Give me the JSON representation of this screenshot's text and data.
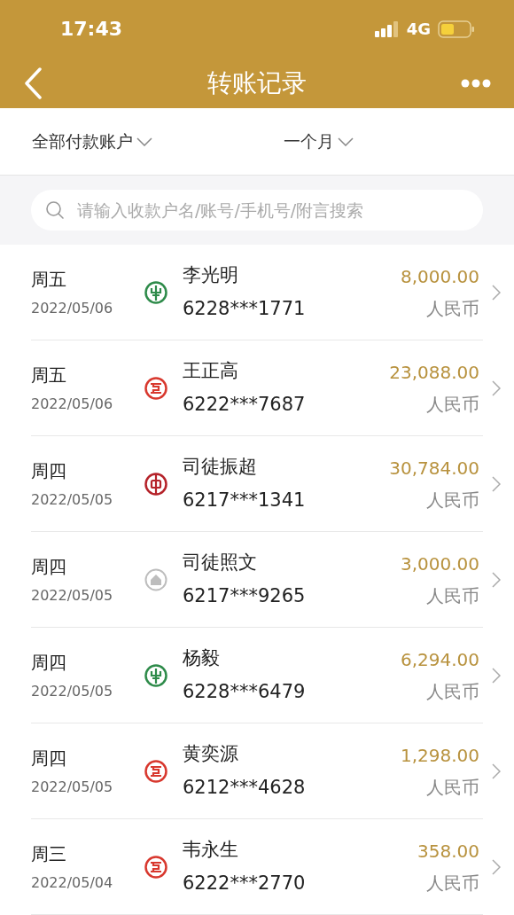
{
  "status_bar": {
    "time": "17:43",
    "network": "4G"
  },
  "nav": {
    "title": "转账记录"
  },
  "filters": [
    {
      "label": "全部付款账户"
    },
    {
      "label": "一个月"
    }
  ],
  "search": {
    "placeholder": "请输入收款户名/账号/手机号/附言搜索"
  },
  "records": [
    {
      "weekday": "周五",
      "date": "2022/05/06",
      "kind": "abc",
      "color": "#2e8b4a",
      "name": "李光明",
      "account": "6228***1771",
      "amount": "8,000.00",
      "currency": "人民币"
    },
    {
      "weekday": "周五",
      "date": "2022/05/06",
      "kind": "icbc",
      "color": "#d8382e",
      "name": "王正高",
      "account": "6222***7687",
      "amount": "23,088.00",
      "currency": "人民币"
    },
    {
      "weekday": "周四",
      "date": "2022/05/05",
      "kind": "boc",
      "color": "#b5232a",
      "name": "司徒振超",
      "account": "6217***1341",
      "amount": "30,784.00",
      "currency": "人民币"
    },
    {
      "weekday": "周四",
      "date": "2022/05/05",
      "kind": "generic",
      "color": "#bdbdbd",
      "name": "司徒照文",
      "account": "6217***9265",
      "amount": "3,000.00",
      "currency": "人民币"
    },
    {
      "weekday": "周四",
      "date": "2022/05/05",
      "kind": "abc",
      "color": "#2e8b4a",
      "name": "杨毅",
      "account": "6228***6479",
      "amount": "6,294.00",
      "currency": "人民币"
    },
    {
      "weekday": "周四",
      "date": "2022/05/05",
      "kind": "icbc",
      "color": "#d8382e",
      "name": "黄奕源",
      "account": "6212***4628",
      "amount": "1,298.00",
      "currency": "人民币"
    },
    {
      "weekday": "周三",
      "date": "2022/05/04",
      "kind": "icbc",
      "color": "#d8382e",
      "name": "韦永生",
      "account": "6222***2770",
      "amount": "358.00",
      "currency": "人民币"
    }
  ]
}
